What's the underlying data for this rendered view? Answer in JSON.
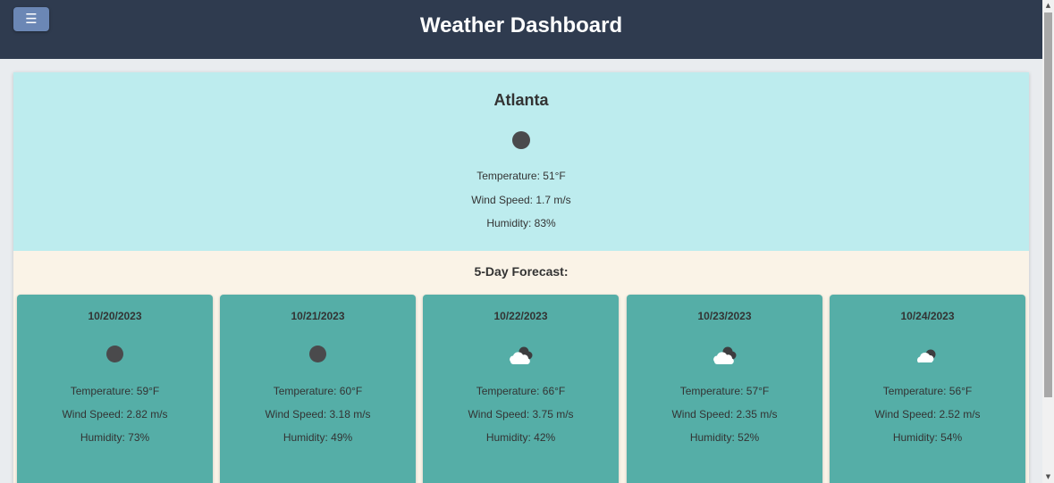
{
  "header": {
    "menu_icon": "☰",
    "title": "Weather Dashboard",
    "background": "#2f3b4f",
    "menu_button_color": "#6b87b5"
  },
  "current": {
    "city": "Atlanta",
    "icon": "moon-icon",
    "temperature": "Temperature: 51°F",
    "wind": "Wind Speed: 1.7 m/s",
    "humidity": "Humidity: 83%",
    "background": "#bdecee"
  },
  "forecast": {
    "title": "5-Day Forecast:",
    "card_color": "#55aea7",
    "days": [
      {
        "date": "10/20/2023",
        "icon": "moon-icon",
        "temperature": "Temperature: 59°F",
        "wind": "Wind Speed: 2.82 m/s",
        "humidity": "Humidity: 73%"
      },
      {
        "date": "10/21/2023",
        "icon": "moon-icon",
        "temperature": "Temperature: 60°F",
        "wind": "Wind Speed: 3.18 m/s",
        "humidity": "Humidity: 49%"
      },
      {
        "date": "10/22/2023",
        "icon": "cloud-night-icon",
        "temperature": "Temperature: 66°F",
        "wind": "Wind Speed: 3.75 m/s",
        "humidity": "Humidity: 42%"
      },
      {
        "date": "10/23/2023",
        "icon": "cloud-night-icon",
        "temperature": "Temperature: 57°F",
        "wind": "Wind Speed: 2.35 m/s",
        "humidity": "Humidity: 52%"
      },
      {
        "date": "10/24/2023",
        "icon": "cloud-night-icon",
        "temperature": "Temperature: 56°F",
        "wind": "Wind Speed: 2.52 m/s",
        "humidity": "Humidity: 54%"
      }
    ]
  },
  "scrollbar": {
    "up_arrow": "▲",
    "down_arrow": "▼"
  }
}
